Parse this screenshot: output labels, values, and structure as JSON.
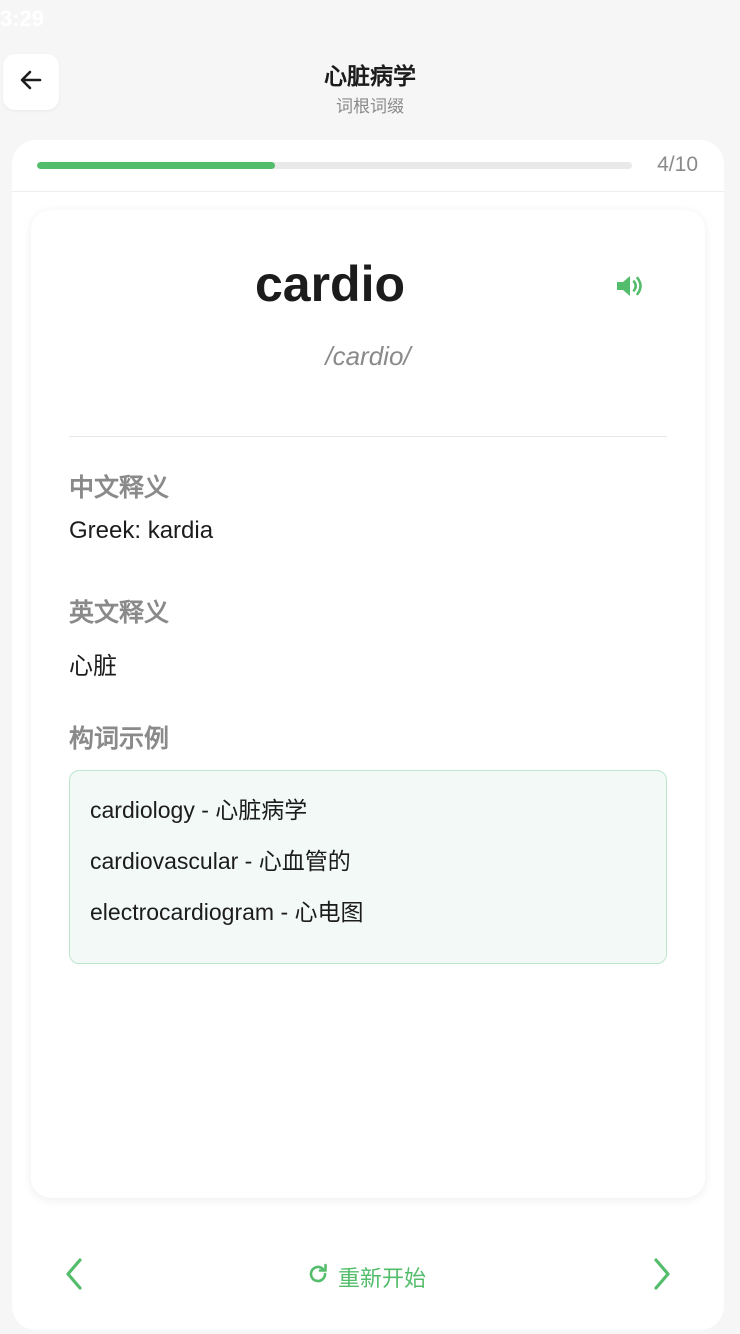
{
  "status_bar": {
    "time": "3:29"
  },
  "header": {
    "title": "心脏病学",
    "subtitle": "词根词缀",
    "back_icon": "arrow-left-icon"
  },
  "progress": {
    "current": 4,
    "total": 10,
    "label": "4/10",
    "fraction": 0.4
  },
  "card": {
    "word": "cardio",
    "phonetic": "/cardio/",
    "speaker_icon": "speaker-icon",
    "sections": {
      "chinese_label": "中文释义",
      "chinese_value": "Greek: kardia",
      "english_label": "英文释义",
      "english_value": "心脏",
      "examples_label": "构词示例"
    },
    "examples": [
      "cardiology - 心脏病学",
      "cardiovascular - 心血管的",
      "electrocardiogram - 心电图"
    ]
  },
  "footer": {
    "prev_icon": "chevron-left-icon",
    "next_icon": "chevron-right-icon",
    "restart_icon": "refresh-icon",
    "restart_label": "重新开始"
  },
  "colors": {
    "accent": "#54bd6c",
    "background": "#f6f6f6",
    "example_bg": "#f2f9f6",
    "example_border": "#bfe6cf",
    "muted_text": "#8a8a8a"
  }
}
